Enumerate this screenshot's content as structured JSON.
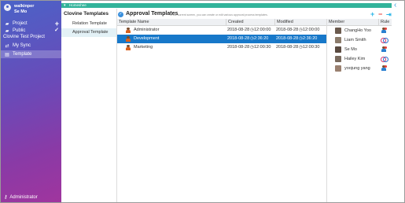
{
  "sidebar": {
    "user_name_line1": "walkinper",
    "user_name_line2": "Se Mo",
    "items": [
      {
        "label": "Project",
        "icon": "folder-icon",
        "action": "+"
      },
      {
        "label": "Public",
        "icon": "folder-icon",
        "action": "✓"
      },
      {
        "label": "Clovine Test Project",
        "icon": "",
        "action": ""
      },
      {
        "label": "My Sync",
        "icon": "sync-icon",
        "action": ""
      },
      {
        "label": "Template",
        "icon": "template-icon",
        "action": ""
      }
    ],
    "admin_label": "Administrator"
  },
  "topbar": {
    "label": "Homeshee"
  },
  "templates_panel": {
    "title": "Clovine Templates",
    "items": [
      {
        "label": "Relation Template"
      },
      {
        "label": "Approval Template"
      }
    ]
  },
  "approval": {
    "title": "Approval Templates",
    "description": "In the current screen, you can create or edit various approval process templates."
  },
  "table": {
    "columns": [
      "Template Name",
      "Created",
      "Modified"
    ],
    "rows": [
      {
        "name": "Administrator",
        "created_date": "2018-08-28",
        "created_time": "12:00:00",
        "modified_date": "2018-08-28",
        "modified_time": "12:00:00"
      },
      {
        "name": "Development",
        "created_date": "2018-08-28",
        "created_time": "2:36:20",
        "modified_date": "2018-08-28",
        "modified_time": "2:36:20"
      },
      {
        "name": "Marketing",
        "created_date": "2018-08-28",
        "created_time": "12:00:30",
        "modified_date": "2018-08-28",
        "modified_time": "12:00:30"
      }
    ]
  },
  "members": {
    "columns": [
      "Member",
      "Rule"
    ],
    "rows": [
      {
        "name": "ChangHo Yoo",
        "rule": "user-icon"
      },
      {
        "name": "Liam Smith",
        "rule": "ring-icon"
      },
      {
        "name": "Se Mo",
        "rule": "user-icon"
      },
      {
        "name": "Hailey Kim",
        "rule": "ring-icon"
      },
      {
        "name": "yoojung yang",
        "rule": "user-icon"
      }
    ]
  },
  "colors": {
    "accent": "#1778c9",
    "topbar": "#32b39a",
    "sidebar_top": "#4a63c8",
    "sidebar_bottom": "#a0359e"
  }
}
